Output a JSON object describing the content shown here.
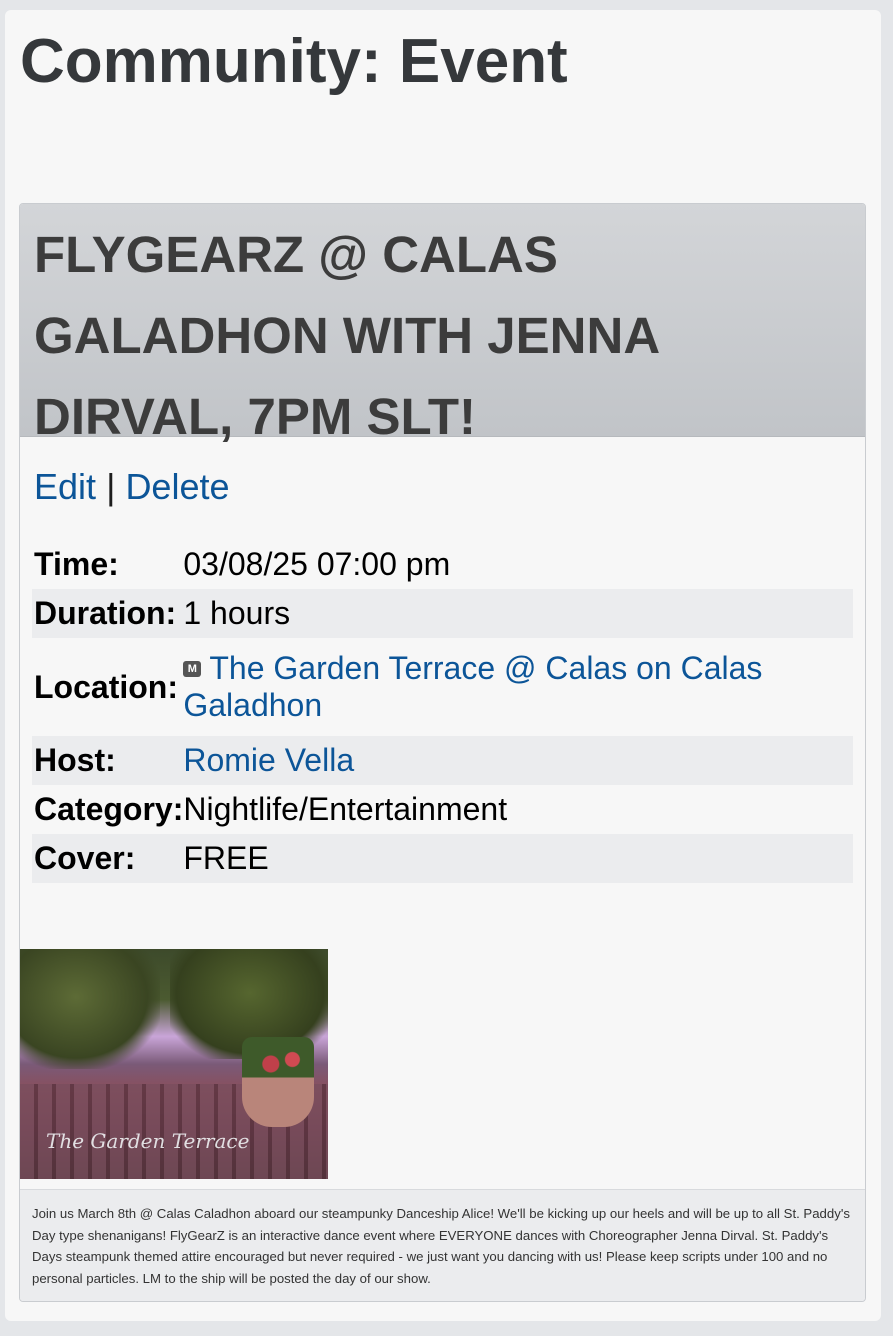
{
  "page": {
    "title": "Community: Event"
  },
  "event": {
    "title": "FLYGEARZ @ CALAS GALADHON WITH JENNA DIRVAL, 7PM SLT!",
    "actions": {
      "edit": "Edit",
      "separator": "|",
      "delete": "Delete"
    },
    "details": {
      "time_label": "Time:",
      "time_value": "03/08/25 07:00 pm",
      "duration_label": "Duration:",
      "duration_value": "1 hours",
      "location_label": "Location:",
      "location_badge": "M",
      "location_value": "The Garden Terrace @ Calas on Calas Galadhon",
      "host_label": "Host:",
      "host_value": "Romie Vella",
      "category_label": "Category:",
      "category_value": "Nightlife/Entertainment",
      "cover_label": "Cover:",
      "cover_value": "FREE"
    },
    "image_caption": "The Garden Terrace",
    "description": "Join us March 8th @ Calas Caladhon aboard our steampunky Danceship Alice! We'll be kicking up our heels and will be up to all St. Paddy's Day type shenanigans! FlyGearZ is an interactive dance event where EVERYONE dances with Choreographer Jenna Dirval. St. Paddy's Days steampunk themed attire encouraged but never required - we just want you dancing with us! Please keep scripts under 100 and no personal particles. LM to the ship will be posted the day of our show."
  },
  "colors": {
    "link": "#0c5598",
    "header_bg": "#c8cbcf",
    "alt_row": "#ebecee",
    "title_text": "#35383b"
  }
}
